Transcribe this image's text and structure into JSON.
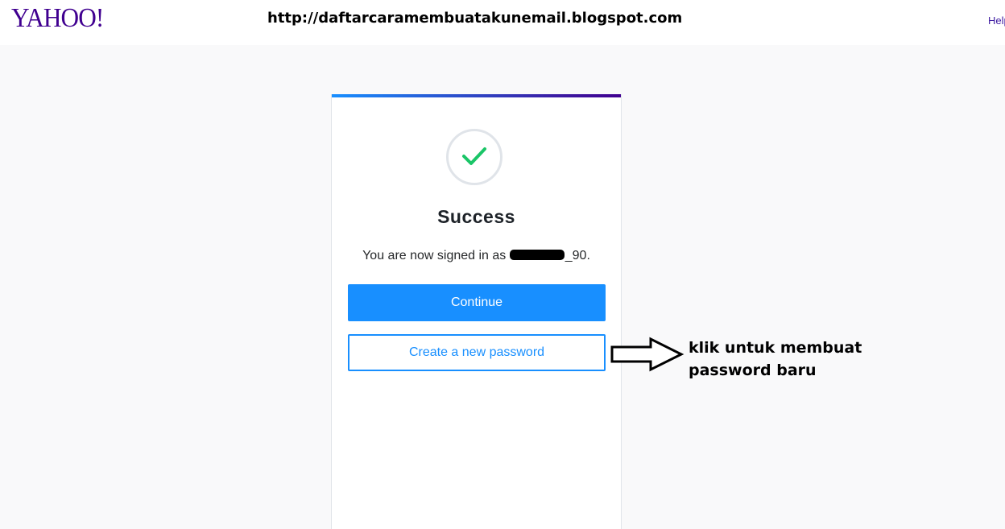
{
  "header": {
    "logo_text": "YAHOO!",
    "watermark_url": "http://daftarcaramembuatakunemail.blogspot.com",
    "help_label": "Help"
  },
  "card": {
    "title": "Success",
    "signed_in_prefix": "You are now signed in as",
    "username_suffix": "_90.",
    "continue_label": "Continue",
    "new_password_label": "Create a new password"
  },
  "annotation": {
    "line1": "klik untuk membuat",
    "line2": "password baru"
  },
  "icons": {
    "success": "checkmark-icon",
    "annotation_arrow": "arrow-right-icon"
  },
  "colors": {
    "brand_purple": "#400090",
    "accent_blue": "#188fff",
    "success_green": "#1ac567"
  }
}
